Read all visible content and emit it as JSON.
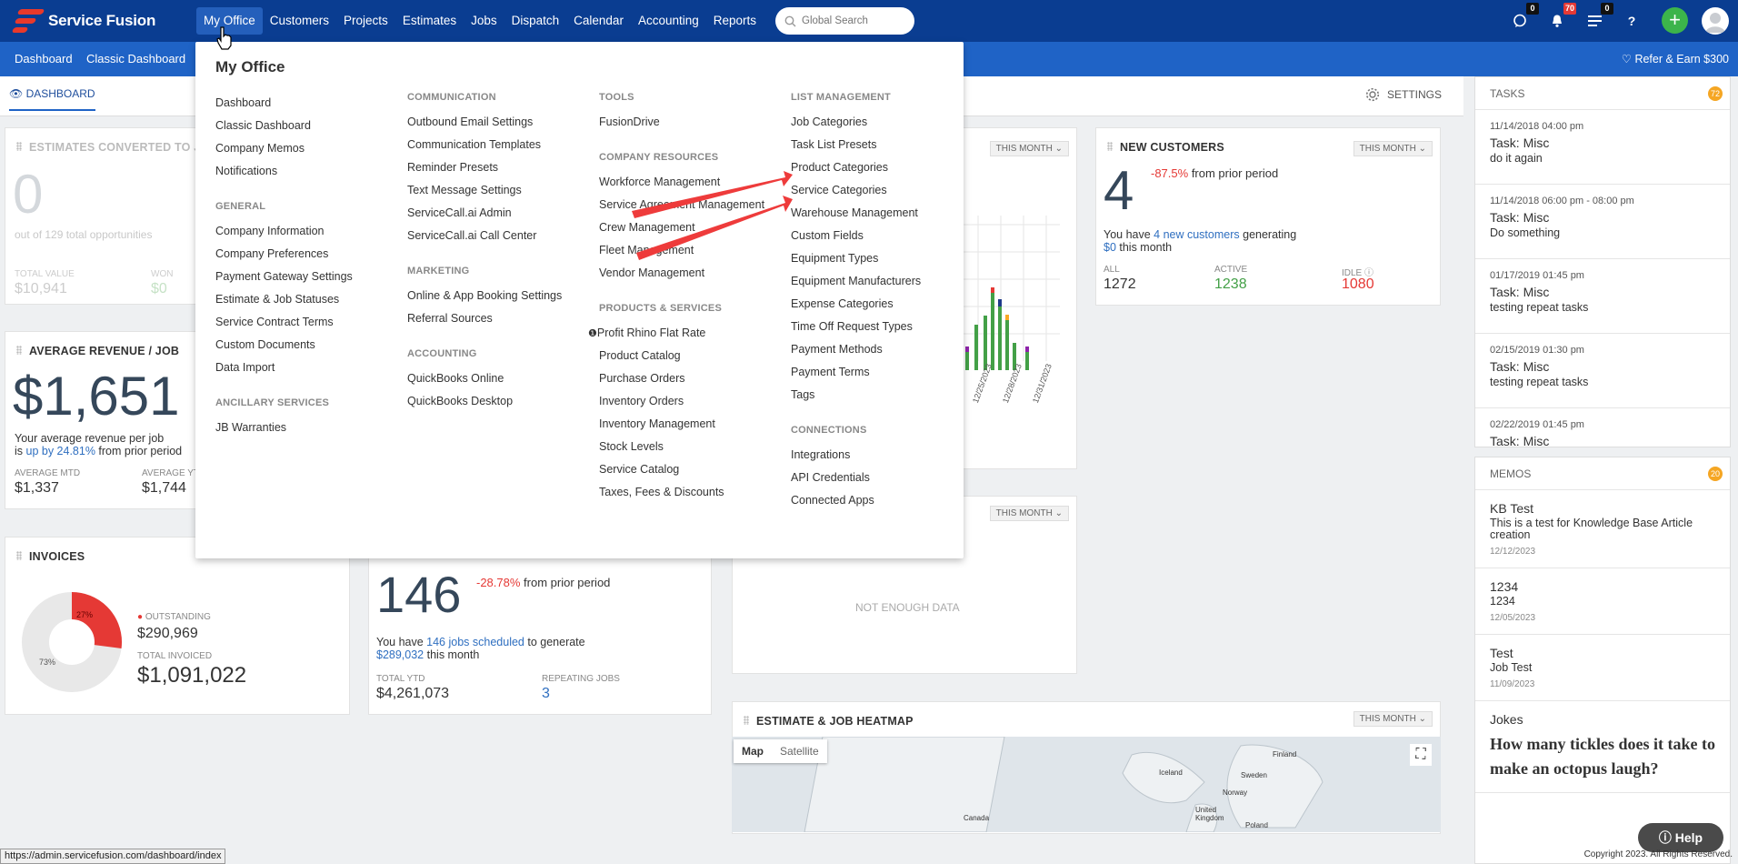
{
  "topbar": {
    "brand": "Service Fusion",
    "nav": [
      "My Office",
      "Customers",
      "Projects",
      "Estimates",
      "Jobs",
      "Dispatch",
      "Calendar",
      "Accounting",
      "Reports"
    ],
    "search_placeholder": "Global Search",
    "icons": [
      {
        "name": "chat-icon",
        "badge": "0"
      },
      {
        "name": "bell-icon",
        "badge": "70"
      },
      {
        "name": "list-icon",
        "badge": "0"
      },
      {
        "name": "help-icon",
        "badge": ""
      }
    ],
    "plus": "+"
  },
  "subbar": {
    "items": [
      "Dashboard",
      "Classic Dashboard"
    ],
    "refer": "Refer & Earn $300"
  },
  "dashboard": {
    "tab": "DASHBOARD",
    "settings": "SETTINGS"
  },
  "cards": {
    "estimates": {
      "title": "ESTIMATES CONVERTED TO JO",
      "value": "0",
      "sub": "out of 129 total opportunities",
      "l1": "TOTAL VALUE",
      "v1": "$10,941",
      "l2": "WON",
      "v2": "$0"
    },
    "avg_revenue": {
      "title": "AVERAGE REVENUE / JOB",
      "value": "$1,651",
      "line1": "Your average revenue per job",
      "line2a": "is ",
      "line2b": "up by 24.81%",
      "line2c": " from prior period",
      "l1": "AVERAGE MTD",
      "v1": "$1,337",
      "l2": "AVERAGE YT",
      "v2": "$1,744"
    },
    "invoices": {
      "title": "INVOICES",
      "pct_out": "27%",
      "pct_rest": "73%",
      "l1": "OUTSTANDING",
      "v1": "$290,969",
      "l2": "TOTAL INVOICED",
      "v2": "$1,091,022"
    },
    "jobs": {
      "value": "146",
      "pct": "-28.78%",
      "from": " from prior period",
      "line1a": "You have ",
      "line1b": "146 jobs scheduled",
      "line1c": " to generate",
      "line2a": "$289,032",
      "line2b": " this month",
      "l1": "TOTAL YTD",
      "v1": "$4,261,073",
      "l2": "REPEATING JOBS",
      "v2": "3"
    },
    "chart": {
      "period": "THIS MONTH",
      "dates": [
        "12/25/2023",
        "12/28/2023",
        "12/31/2023"
      ]
    },
    "new_customers": {
      "title": "NEW CUSTOMERS",
      "period": "THIS MONTH",
      "value": "4",
      "pct": "-87.5%",
      "from": " from prior period",
      "line1a": "You have ",
      "line1b": "4 new customers",
      "line1c": " generating",
      "line2a": "$0",
      "line2b": " this month",
      "l1": "ALL",
      "v1": "1272",
      "l2": "ACTIVE",
      "v2": "1238",
      "l3": "IDLE",
      "v3": "1080"
    },
    "empty": {
      "period": "THIS MONTH",
      "msg": "NOT ENOUGH DATA"
    },
    "heatmap": {
      "title": "ESTIMATE & JOB HEATMAP",
      "period": "THIS MONTH",
      "map_tab": "Map",
      "sat_tab": "Satellite",
      "labels": [
        "Finland",
        "Iceland",
        "Sweden",
        "Norway",
        "United Kingdom",
        "Canada",
        "Poland"
      ]
    }
  },
  "megamenu": {
    "title": "My Office",
    "columns": [
      [
        {
          "head": "",
          "items": [
            "Dashboard",
            "Classic Dashboard",
            "Company Memos",
            "Notifications"
          ]
        },
        {
          "head": "GENERAL",
          "items": [
            "Company Information",
            "Company Preferences",
            "Payment Gateway Settings",
            "Estimate & Job Statuses",
            "Service Contract Terms",
            "Custom Documents",
            "Data Import"
          ]
        },
        {
          "head": "ANCILLARY SERVICES",
          "items": [
            "JB Warranties"
          ]
        }
      ],
      [
        {
          "head": "COMMUNICATION",
          "items": [
            "Outbound Email Settings",
            "Communication Templates",
            "Reminder Presets",
            "Text Message Settings",
            "ServiceCall.ai Admin",
            "ServiceCall.ai Call Center"
          ]
        },
        {
          "head": "MARKETING",
          "items": [
            "Online & App Booking Settings",
            "Referral Sources"
          ]
        },
        {
          "head": "ACCOUNTING",
          "items": [
            "QuickBooks Online",
            "QuickBooks Desktop"
          ]
        }
      ],
      [
        {
          "head": "TOOLS",
          "items": [
            "FusionDrive"
          ]
        },
        {
          "head": "COMPANY RESOURCES",
          "items": [
            "Workforce Management",
            "Service Agreement Management",
            "Crew Management",
            "Fleet Management",
            "Vendor Management"
          ]
        },
        {
          "head": "PRODUCTS & SERVICES",
          "items": [
            "Profit Rhino Flat Rate",
            "Product Catalog",
            "Purchase Orders",
            "Inventory Orders",
            "Inventory Management",
            "Stock Levels",
            "Service Catalog",
            "Taxes, Fees & Discounts"
          ]
        }
      ],
      [
        {
          "head": "LIST MANAGEMENT",
          "items": [
            "Job Categories",
            "Task List Presets",
            "Product Categories",
            "Service Categories",
            "Warehouse Management",
            "Custom Fields",
            "Equipment Types",
            "Equipment Manufacturers",
            "Expense Categories",
            "Time Off Request Types",
            "Payment Methods",
            "Payment Terms",
            "Tags"
          ]
        },
        {
          "head": "CONNECTIONS",
          "items": [
            "Integrations",
            "API Credentials",
            "Connected Apps"
          ]
        }
      ]
    ]
  },
  "tasks": {
    "title": "TASKS",
    "count": "72",
    "items": [
      {
        "date": "11/14/2018 04:00 pm",
        "title": "Task: Misc",
        "note": "do it again"
      },
      {
        "date": "11/14/2018 06:00 pm - 08:00 pm",
        "title": "Task: Misc",
        "note": "Do something"
      },
      {
        "date": "01/17/2019 01:45 pm",
        "title": "Task: Misc",
        "note": "testing repeat tasks"
      },
      {
        "date": "02/15/2019 01:30 pm",
        "title": "Task: Misc",
        "note": "testing repeat tasks"
      },
      {
        "date": "02/22/2019 01:45 pm",
        "title": "Task: Misc",
        "note": ""
      }
    ]
  },
  "memos": {
    "title": "MEMOS",
    "count": "20",
    "items": [
      {
        "title": "KB Test",
        "note": "This is a test for Knowledge Base Article creation",
        "date": "12/12/2023"
      },
      {
        "title": "1234",
        "note": "1234",
        "date": "12/05/2023"
      },
      {
        "title": "Test",
        "note": "Job Test",
        "date": "11/09/2023"
      },
      {
        "title": "Jokes",
        "note": "How many tickles does it take to make an octopus laugh?",
        "date": ""
      }
    ]
  },
  "help": "Help",
  "status_url": "https://admin.servicefusion.com/dashboard/index",
  "copyright": "Copyright 2023. All Rights Reserved.",
  "colors": {
    "topbar": "#0a3d91",
    "subbar": "#1f63c6",
    "accent_red": "#e53935",
    "arrow": "#ee3b3b"
  }
}
